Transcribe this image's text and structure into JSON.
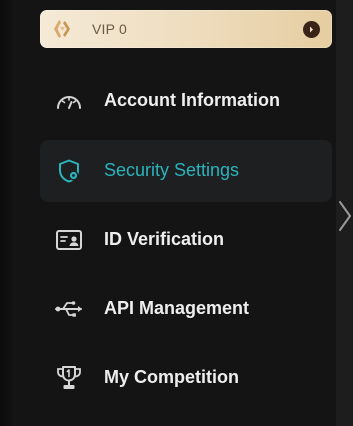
{
  "vip_card": {
    "label": "VIP 0",
    "logo_icon": "vip-logo-icon",
    "arrow_icon": "chevron-right-icon"
  },
  "menu": {
    "items": [
      {
        "label": "Account Information",
        "icon": "dashboard-gauge-icon",
        "active": false
      },
      {
        "label": "Security Settings",
        "icon": "security-shield-icon",
        "active": true
      },
      {
        "label": "ID Verification",
        "icon": "id-card-icon",
        "active": false
      },
      {
        "label": "API Management",
        "icon": "usb-icon",
        "active": false
      },
      {
        "label": "My Competition",
        "icon": "trophy-icon",
        "active": false
      }
    ]
  },
  "colors": {
    "accent": "#2bb3bd",
    "text": "#eeeeee",
    "background": "#141414",
    "active_bg": "#1e1f20",
    "vip_gold": "#efdfc2"
  },
  "page_arrow_icon": "chevron-right-icon"
}
